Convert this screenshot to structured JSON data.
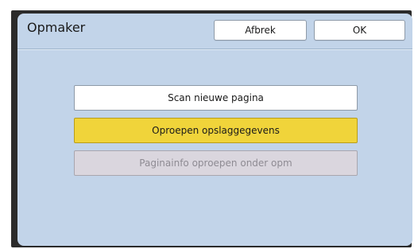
{
  "dialog": {
    "title": "Opmaker",
    "cancel_label": "Afbrek",
    "ok_label": "OK"
  },
  "menu": {
    "items": [
      {
        "label": "Scan nieuwe pagina",
        "state": "enabled"
      },
      {
        "label": "Oproepen opslaggegevens",
        "state": "selected"
      },
      {
        "label": "Paginainfo oproepen onder opm",
        "state": "disabled"
      }
    ]
  },
  "colors": {
    "panel_bg": "#c2d4e9",
    "selected_bg": "#f0d43a",
    "disabled_bg": "#dad6de",
    "frame": "#2b2b2b"
  }
}
